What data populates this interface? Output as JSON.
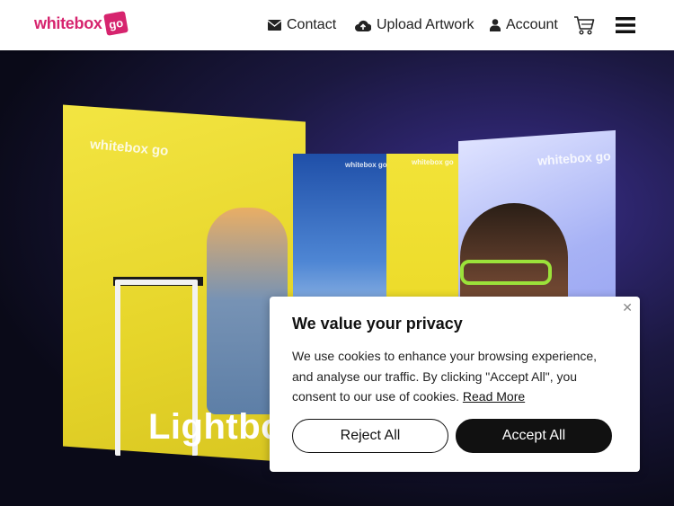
{
  "brand": {
    "logo_text": "whitebox",
    "logo_badge": "go",
    "accent": "#d6246e"
  },
  "nav": {
    "contact": {
      "label": "Contact",
      "icon": "envelope-icon"
    },
    "upload": {
      "label": "Upload Artwork",
      "icon": "cloud-upload-icon"
    },
    "account": {
      "label": "Account",
      "icon": "user-icon"
    },
    "cart": {
      "icon": "cart-icon"
    },
    "menu": {
      "icon": "hamburger-icon"
    }
  },
  "hero": {
    "title": "Lightbox",
    "panel_logo": "whitebox go"
  },
  "cookie_banner": {
    "title": "We value your privacy",
    "body": "We use cookies to enhance your browsing experience, and analyse our traffic. By clicking \"Accept All\", you consent to our use of cookies.",
    "read_more": "Read More",
    "reject_label": "Reject All",
    "accept_label": "Accept All",
    "close_icon": "close-icon"
  }
}
